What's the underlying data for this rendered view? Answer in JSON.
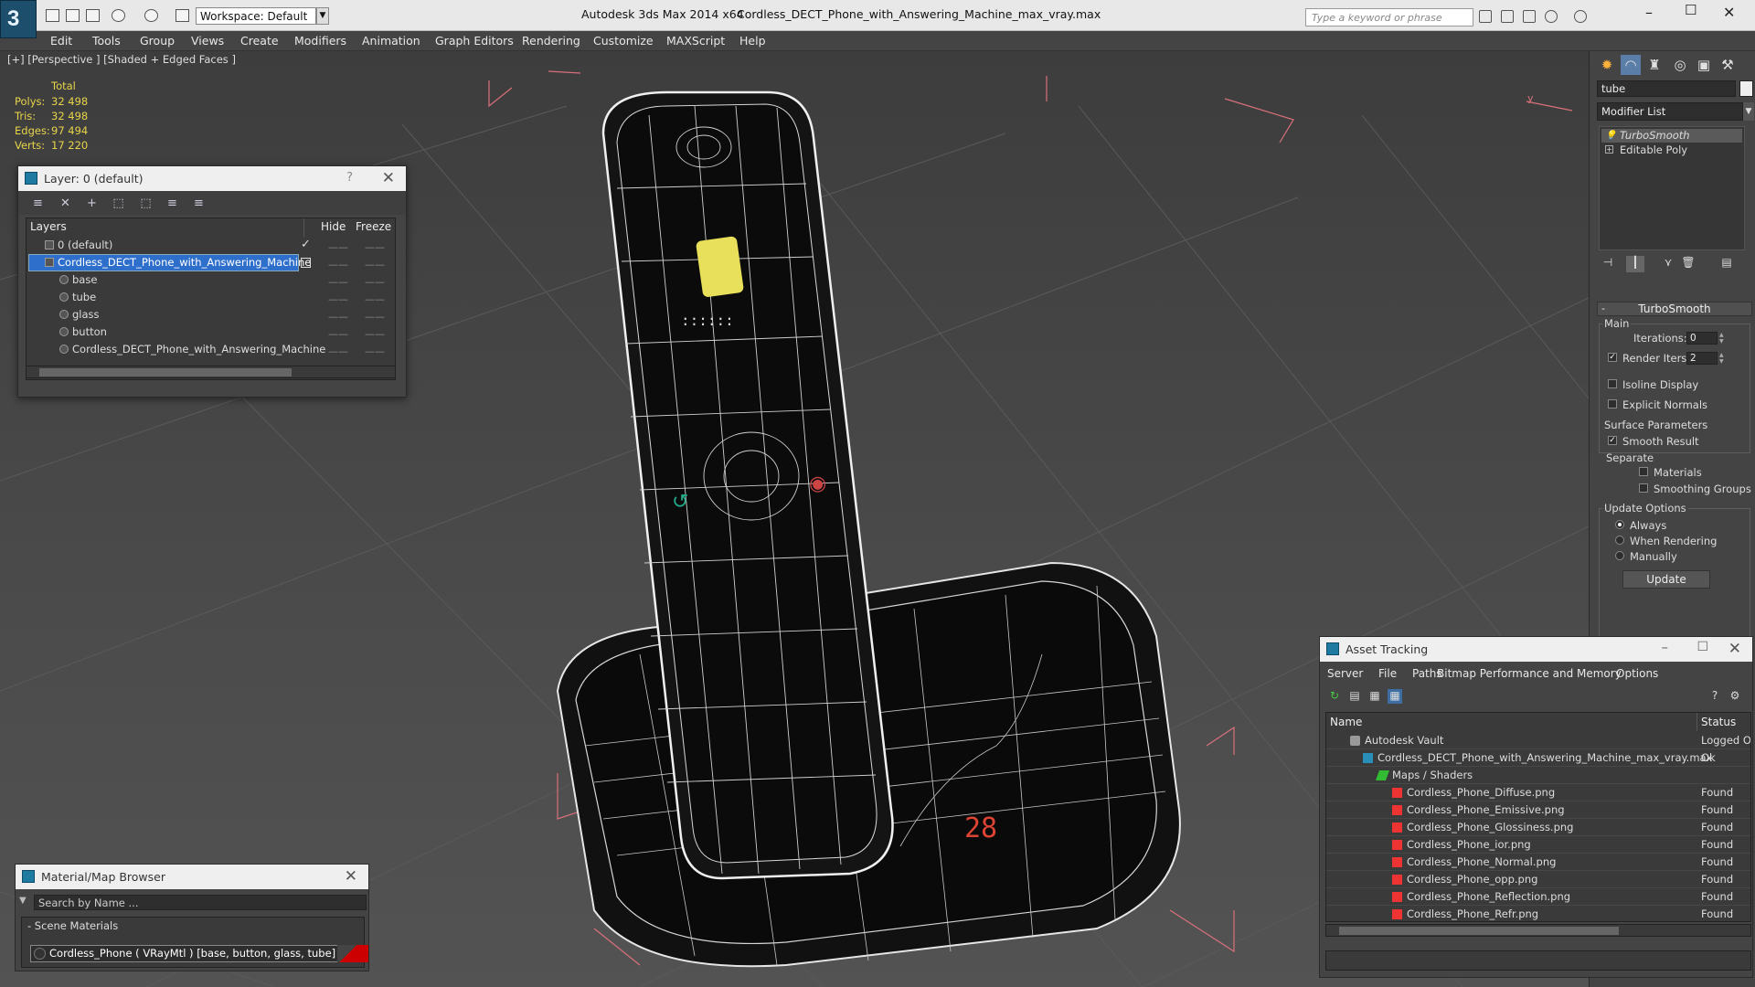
{
  "titlebar": {
    "workspace": "Workspace: Default",
    "app_title": "Autodesk 3ds Max  2014 x64",
    "doc_title": "Cordless_DECT_Phone_with_Answering_Machine_max_vray.max",
    "search_placeholder": "Type a keyword or phrase"
  },
  "menu": [
    "Edit",
    "Tools",
    "Group",
    "Views",
    "Create",
    "Modifiers",
    "Animation",
    "Graph Editors",
    "Rendering",
    "Customize",
    "MAXScript",
    "Help"
  ],
  "viewport": {
    "label": "[+] [Perspective ] [Shaded + Edged Faces ]",
    "stats": {
      "header": "Total",
      "rows": [
        {
          "label": "Polys:",
          "value": "32 498"
        },
        {
          "label": "Tris:",
          "value": "32 498"
        },
        {
          "label": "Edges:",
          "value": "97 494"
        },
        {
          "label": "Verts:",
          "value": "17 220"
        }
      ]
    },
    "axis_label": "y"
  },
  "layer_window": {
    "title": "Layer: 0 (default)",
    "help": "?",
    "columns": {
      "layers": "Layers",
      "hide": "Hide",
      "freeze": "Freeze"
    },
    "rows": [
      {
        "name": "0 (default)"
      },
      {
        "name": "Cordless_DECT_Phone_with_Answering_Machine"
      },
      {
        "name": "base"
      },
      {
        "name": "tube"
      },
      {
        "name": "glass"
      },
      {
        "name": "button"
      },
      {
        "name": "Cordless_DECT_Phone_with_Answering_Machine"
      }
    ]
  },
  "material_browser": {
    "title": "Material/Map Browser",
    "search_placeholder": "Search by Name ...",
    "group": "- Scene Materials",
    "item": "Cordless_Phone  ( VRayMtl )  [base, button, glass, tube]"
  },
  "command_panel": {
    "object_name": "tube",
    "modifier_list": "Modifier List",
    "stack": [
      "TurboSmooth",
      "Editable Poly"
    ],
    "rollout": "TurboSmooth",
    "main": {
      "label": "Main",
      "iterations_label": "Iterations:",
      "iterations": "0",
      "render_iters_label": "Render Iters:",
      "render_iters": "2",
      "isoline": "Isoline Display",
      "explicit_normals": "Explicit Normals"
    },
    "surface": {
      "label": "Surface Parameters",
      "smooth_result": "Smooth Result",
      "separate": "Separate",
      "materials": "Materials",
      "smoothing_groups": "Smoothing Groups"
    },
    "update": {
      "label": "Update Options",
      "always": "Always",
      "when_rendering": "When Rendering",
      "manually": "Manually",
      "button": "Update"
    }
  },
  "asset_tracking": {
    "title": "Asset Tracking",
    "menu": [
      "Server",
      "File",
      "Paths",
      "Bitmap Performance and Memory",
      "Options"
    ],
    "columns": {
      "name": "Name",
      "status": "Status"
    },
    "rows": [
      {
        "name": "Autodesk Vault",
        "status": "Logged Out"
      },
      {
        "name": "Cordless_DECT_Phone_with_Answering_Machine_max_vray.max",
        "status": "Ok"
      },
      {
        "name": "Maps / Shaders",
        "status": ""
      },
      {
        "name": "Cordless_Phone_Diffuse.png",
        "status": "Found"
      },
      {
        "name": "Cordless_Phone_Emissive.png",
        "status": "Found"
      },
      {
        "name": "Cordless_Phone_Glossiness.png",
        "status": "Found"
      },
      {
        "name": "Cordless_Phone_ior.png",
        "status": "Found"
      },
      {
        "name": "Cordless_Phone_Normal.png",
        "status": "Found"
      },
      {
        "name": "Cordless_Phone_opp.png",
        "status": "Found"
      },
      {
        "name": "Cordless_Phone_Reflection.png",
        "status": "Found"
      },
      {
        "name": "Cordless_Phone_Refr.png",
        "status": "Found"
      }
    ]
  },
  "colors": {
    "selection": "#2f6fcc",
    "stat_text": "#e8d44a",
    "wire": "#e6e6e6",
    "bbox": "#d9707a",
    "screen_glow": "#e8e05a"
  }
}
